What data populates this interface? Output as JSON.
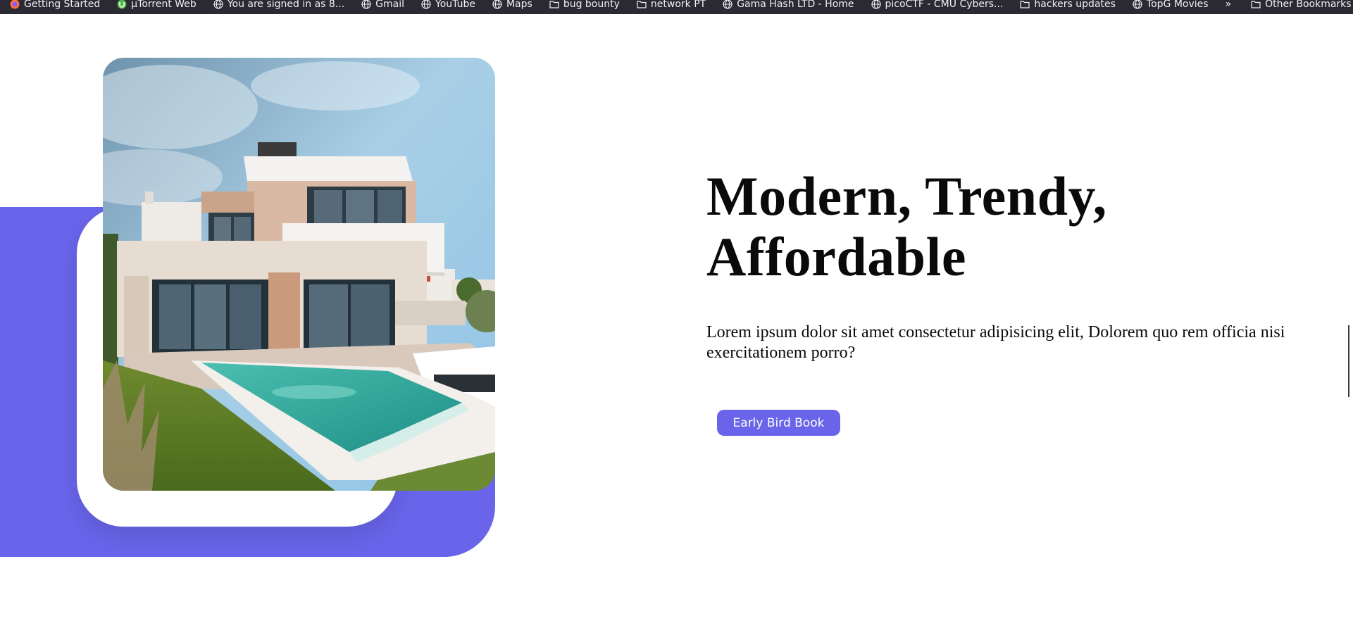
{
  "bookmarks": {
    "items": [
      {
        "label": "Getting Started",
        "icon": "firefox-icon"
      },
      {
        "label": "µTorrent Web",
        "icon": "utorrent-icon"
      },
      {
        "label": "You are signed in as 8...",
        "icon": "globe-icon"
      },
      {
        "label": "Gmail",
        "icon": "globe-icon"
      },
      {
        "label": "YouTube",
        "icon": "globe-icon"
      },
      {
        "label": "Maps",
        "icon": "globe-icon"
      },
      {
        "label": "bug bounty",
        "icon": "folder-icon"
      },
      {
        "label": "network PT",
        "icon": "folder-icon"
      },
      {
        "label": "Gama Hash LTD - Home",
        "icon": "globe-icon"
      },
      {
        "label": "picoCTF - CMU Cybers...",
        "icon": "globe-icon"
      },
      {
        "label": "hackers updates",
        "icon": "folder-icon"
      },
      {
        "label": "TopG Movies",
        "icon": "globe-icon"
      }
    ],
    "overflow_label": "»",
    "other_label": "Other Bookmarks"
  },
  "hero": {
    "headline_line1": "Modern, Trendy,",
    "headline_line2": "Affordable",
    "description": "Lorem ipsum dolor sit amet consectetur adipisicing elit, Dolorem quo rem officia nisi exercitationem porro?",
    "button_label": "Early Bird Book"
  },
  "colors": {
    "accent": "#6964e9",
    "bookmarks_bar": "#2b2a33",
    "text": "#0a0a0a"
  }
}
